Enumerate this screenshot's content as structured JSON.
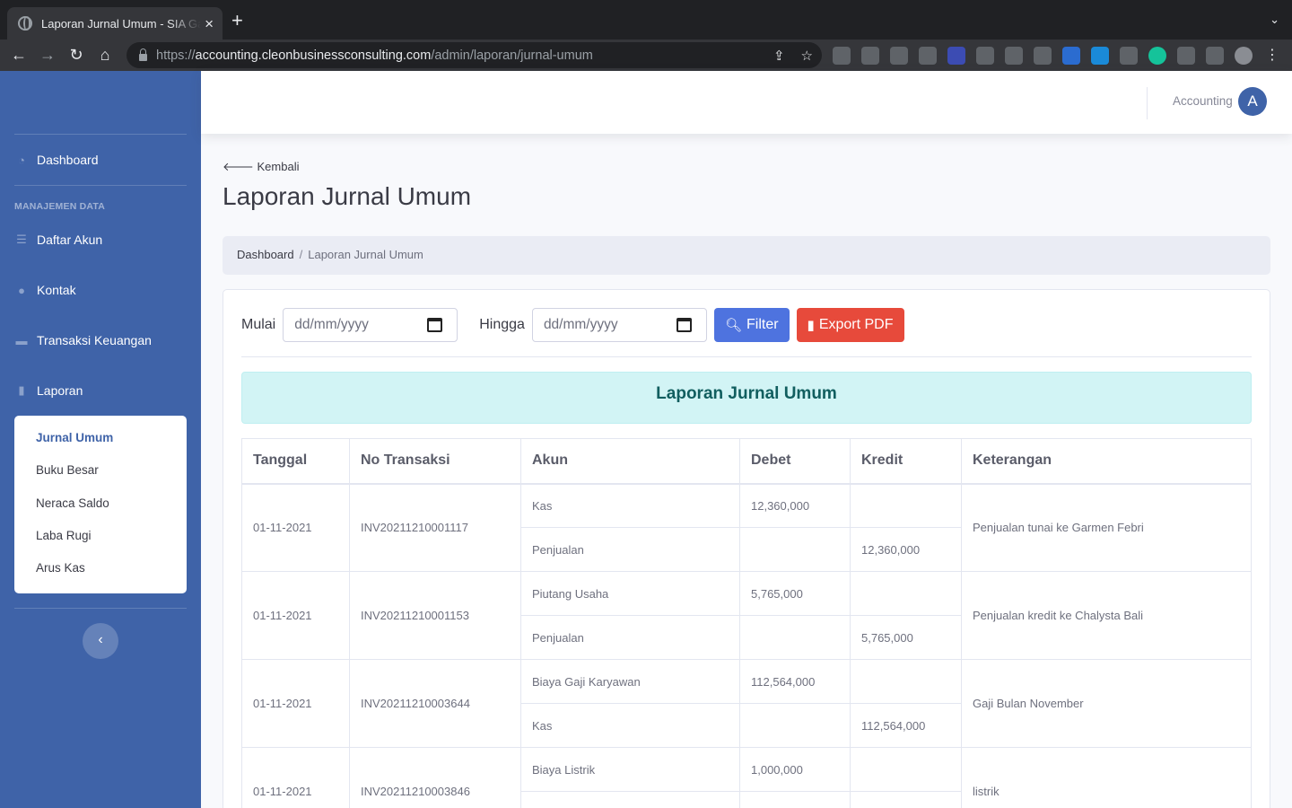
{
  "browser": {
    "tab_title": "Laporan Jurnal Umum - SIA Garmen",
    "tab_close": "×",
    "new_tab": "+",
    "tab_menu": "⌄",
    "url_scheme": "https://",
    "url_host": "accounting.cleonbusinessconsulting.com",
    "url_path": "/admin/laporan/jurnal-umum",
    "back_arrow": "←",
    "forward_arrow": "→",
    "reload": "↻",
    "home": "⌂"
  },
  "sidebar": {
    "dashboard": "Dashboard",
    "heading": "MANAJEMEN DATA",
    "items": [
      {
        "label": "Daftar Akun",
        "icon": "list-icon"
      },
      {
        "label": "Kontak",
        "icon": "users-icon"
      },
      {
        "label": "Transaksi Keuangan",
        "icon": "folder-icon"
      },
      {
        "label": "Laporan",
        "icon": "file-icon"
      }
    ],
    "submenu": [
      "Jurnal Umum",
      "Buku Besar",
      "Neraca Saldo",
      "Laba Rugi",
      "Arus Kas"
    ],
    "toggle": "‹"
  },
  "topbar": {
    "user_name": "Accounting",
    "avatar_letter": "A"
  },
  "main": {
    "back_link": "Kembali",
    "page_title": "Laporan Jurnal Umum",
    "breadcrumb": {
      "home": "Dashboard",
      "separator": "/",
      "current": "Laporan Jurnal Umum"
    },
    "filter": {
      "start_label": "Mulai",
      "start_value": "dd/mm/yyyy",
      "end_label": "Hingga",
      "end_value": "dd/mm/yyyy",
      "filter_button": "Filter",
      "export_button": "Export PDF"
    },
    "report_title": "Laporan Jurnal Umum",
    "table": {
      "headers": [
        "Tanggal",
        "No Transaksi",
        "Akun",
        "Debet",
        "Kredit",
        "Keterangan"
      ],
      "rows": [
        {
          "date": "01-11-2021",
          "no": "INV20211210001117",
          "desc": "Penjualan tunai ke Garmen Febri",
          "entries": [
            {
              "akun": "Kas",
              "debet": "12,360,000",
              "kredit": ""
            },
            {
              "akun": "Penjualan",
              "debet": "",
              "kredit": "12,360,000"
            }
          ]
        },
        {
          "date": "01-11-2021",
          "no": "INV20211210001153",
          "desc": "Penjualan kredit ke Chalysta Bali",
          "entries": [
            {
              "akun": "Piutang Usaha",
              "debet": "5,765,000",
              "kredit": ""
            },
            {
              "akun": "Penjualan",
              "debet": "",
              "kredit": "5,765,000"
            }
          ]
        },
        {
          "date": "01-11-2021",
          "no": "INV20211210003644",
          "desc": "Gaji Bulan November",
          "entries": [
            {
              "akun": "Biaya Gaji Karyawan",
              "debet": "112,564,000",
              "kredit": ""
            },
            {
              "akun": "Kas",
              "debet": "",
              "kredit": "112,564,000"
            }
          ]
        },
        {
          "date": "01-11-2021",
          "no": "INV20211210003846",
          "desc": "listrik",
          "entries": [
            {
              "akun": "Biaya Listrik",
              "debet": "1,000,000",
              "kredit": ""
            },
            {
              "akun": "",
              "debet": "",
              "kredit": ""
            }
          ]
        }
      ]
    }
  },
  "colors": {
    "sidebar": "#3f63a8",
    "filter_button": "#4e73df",
    "export_button": "#e74a3b",
    "banner": "#d2f4f5"
  }
}
